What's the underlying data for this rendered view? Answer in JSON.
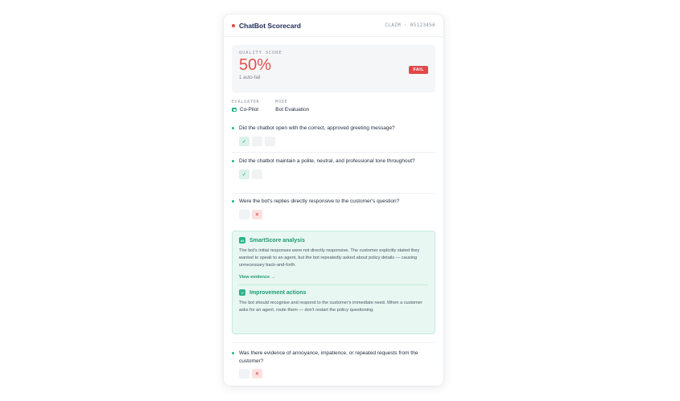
{
  "header": {
    "brand": "ChatBot Scorecard",
    "claim": "CLAIM · 05123456"
  },
  "score": {
    "label": "QUALITY SCORE",
    "value": "50%",
    "sub": "1 auto-fail",
    "badge": "FAIL"
  },
  "meta": {
    "evaluator_label": "EVALUATOR",
    "evaluator": "Co-Pilot",
    "mode_label": "MODE",
    "mode": "Bot Evaluation"
  },
  "questions": [
    {
      "text": "Did the chatbot open with the correct, approved greeting message?",
      "boxes": [
        "✓",
        "",
        ""
      ]
    },
    {
      "text": "Did the chatbot maintain a polite, neutral, and professional tone throughout?",
      "boxes": [
        "✓",
        ""
      ]
    },
    {
      "text": "Were the bot's replies directly responsive to the customer's question?",
      "boxes": [
        "",
        "✕"
      ]
    },
    {
      "text": "Was there evidence of annoyance, impatience, or repeated requests from the customer?",
      "boxes": [
        "",
        "✕"
      ]
    }
  ],
  "smart": {
    "badge": "AI",
    "title": "SmartScore analysis",
    "body": "The bot's initial responses were not directly responsive. The customer explicitly stated they wanted to speak to an agent, but the bot repeatedly asked about policy details — causing unnecessary back-and-forth.",
    "link": "View evidence →",
    "improve_badge": "↗",
    "improve_title": "Improvement actions",
    "improve_body": "The bot should recognise and respond to the customer's immediate need. When a customer asks for an agent, route them — don't restart the policy questioning."
  },
  "colors": {
    "accent": "#2bb38a",
    "fail": "#e04848",
    "brand": "#1c2a55"
  }
}
